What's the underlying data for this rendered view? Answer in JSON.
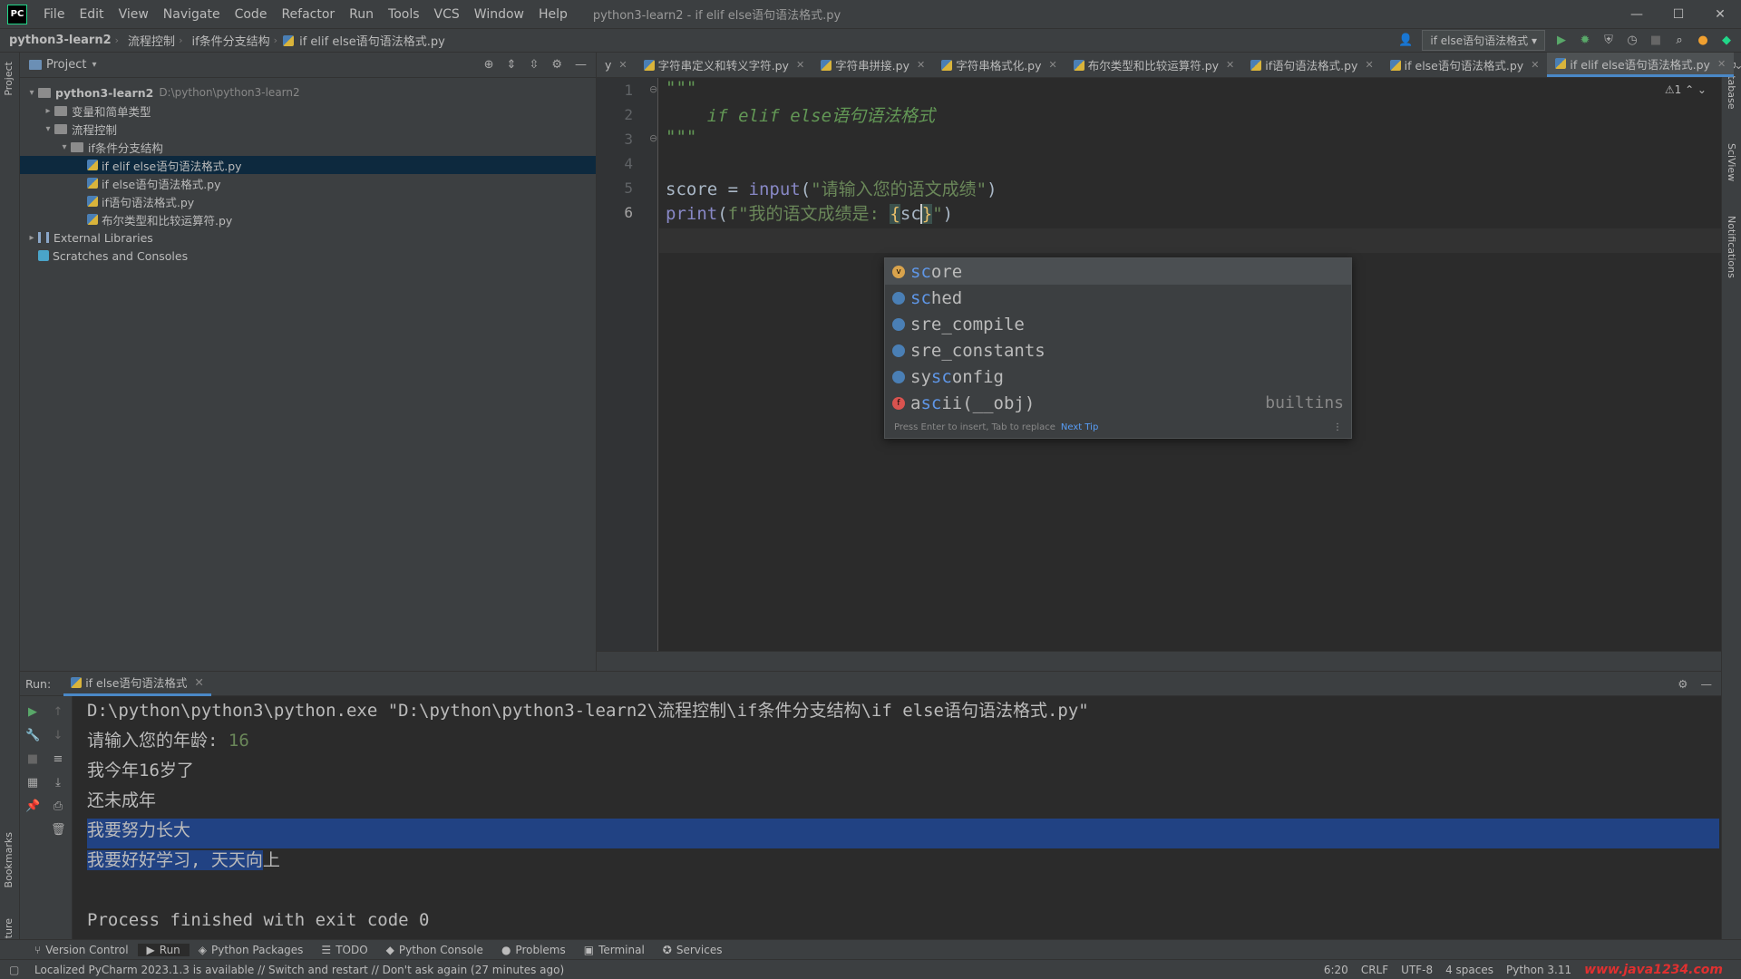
{
  "title_bar": {
    "logo": "PC",
    "menu": [
      "File",
      "Edit",
      "View",
      "Navigate",
      "Code",
      "Refactor",
      "Run",
      "Tools",
      "VCS",
      "Window",
      "Help"
    ],
    "window_title": "python3-learn2 - if elif else语句语法格式.py",
    "controls": [
      "—",
      "☐",
      "✕"
    ]
  },
  "breadcrumb": [
    "python3-learn2",
    "流程控制",
    "if条件分支结构",
    "if elif else语句语法格式.py"
  ],
  "run_config": "if else语句语法格式",
  "project_panel": {
    "title": "Project",
    "tree": [
      {
        "label": "python3-learn2",
        "path": "D:\\python\\python3-learn2",
        "type": "folder",
        "depth": 0,
        "arrow": "▾",
        "bold": true
      },
      {
        "label": "变量和简单类型",
        "type": "folder",
        "depth": 1,
        "arrow": "▸"
      },
      {
        "label": "流程控制",
        "type": "folder",
        "depth": 1,
        "arrow": "▾"
      },
      {
        "label": "if条件分支结构",
        "type": "folder",
        "depth": 2,
        "arrow": "▾"
      },
      {
        "label": "if elif else语句语法格式.py",
        "type": "py",
        "depth": 3,
        "arrow": "",
        "selected": true
      },
      {
        "label": "if else语句语法格式.py",
        "type": "py",
        "depth": 3,
        "arrow": ""
      },
      {
        "label": "if语句语法格式.py",
        "type": "py",
        "depth": 3,
        "arrow": ""
      },
      {
        "label": "布尔类型和比较运算符.py",
        "type": "py",
        "depth": 3,
        "arrow": ""
      },
      {
        "label": "External Libraries",
        "type": "lib",
        "depth": 0,
        "arrow": "▸"
      },
      {
        "label": "Scratches and Consoles",
        "type": "scratch",
        "depth": 0,
        "arrow": ""
      }
    ]
  },
  "editor_tabs": [
    {
      "label": "y",
      "partial": true
    },
    {
      "label": "字符串定义和转义字符.py"
    },
    {
      "label": "字符串拼接.py"
    },
    {
      "label": "字符串格式化.py"
    },
    {
      "label": "布尔类型和比较运算符.py"
    },
    {
      "label": "if语句语法格式.py"
    },
    {
      "label": "if else语句语法格式.py"
    },
    {
      "label": "if elif else语句语法格式.py",
      "active": true
    }
  ],
  "editor": {
    "line_numbers": [
      "1",
      "2",
      "3",
      "4",
      "5",
      "6"
    ],
    "warning": "⚠1",
    "lines": {
      "l1": "\"\"\"",
      "l2": "    if elif else语句语法格式",
      "l3": "\"\"\"",
      "l5a": "score = ",
      "l5fn": "input",
      "l5b": "(",
      "l5str": "\"请输入您的语文成绩\"",
      "l5c": ")",
      "l6fn": "print",
      "l6a": "(",
      "l6str1": "f\"我的语文成绩是: ",
      "l6br1": "{",
      "l6code": "sc",
      "l6br2": "}",
      "l6str2": "\"",
      "l6b": ")"
    }
  },
  "completion": {
    "items": [
      {
        "hl": "sc",
        "rest": "ore",
        "icon": "v",
        "icon_color": "#d9a34c",
        "tail": "",
        "selected": true
      },
      {
        "hl": "sc",
        "rest": "hed",
        "icon": "",
        "icon_color": "#4a7fb5",
        "tail": ""
      },
      {
        "pre": "s",
        "hl": "",
        "rest": "re_compile",
        "icon": "",
        "icon_color": "#4a7fb5",
        "tail": ""
      },
      {
        "pre": "s",
        "hl": "",
        "rest": "re_constants",
        "icon": "",
        "icon_color": "#4a7fb5",
        "tail": ""
      },
      {
        "pre": "sy",
        "hl": "sc",
        "rest": "onfig",
        "icon": "",
        "icon_color": "#4a7fb5",
        "tail": ""
      },
      {
        "pre": "a",
        "hl": "sc",
        "rest": "ii(__obj)",
        "icon": "f",
        "icon_color": "#d9534f",
        "tail": "builtins"
      }
    ],
    "footer": "Press Enter to insert, Tab to replace",
    "next_tip": "Next Tip"
  },
  "run_panel": {
    "label": "Run:",
    "tab": "if else语句语法格式",
    "lines": [
      "D:\\python\\python3\\python.exe \"D:\\python\\python3-learn2\\流程控制\\if条件分支结构\\if else语句语法格式.py\"",
      "请输入您的年龄: ",
      "我今年16岁了",
      "还未成年",
      "我要努力长大",
      "我要好好学习, 天天向上",
      "",
      "Process finished with exit code 0"
    ],
    "input_value": "16",
    "line6_sel": "我要好好学习, 天天向",
    "line6_rest": "上"
  },
  "bottom_tools": [
    "Version Control",
    "Run",
    "Python Packages",
    "TODO",
    "Python Console",
    "Problems",
    "Terminal",
    "Services"
  ],
  "left_strip": [
    "Project",
    "Bookmarks",
    "Structure"
  ],
  "right_strip": [
    "Database",
    "SciView",
    "Notifications"
  ],
  "status": {
    "message": "Localized PyCharm 2023.1.3 is available // Switch and restart // Don't ask again (27 minutes ago)",
    "position": "6:20",
    "line_sep": "CRLF",
    "encoding": "UTF-8",
    "indent": "4 spaces",
    "interpreter": "Python 3.11",
    "watermark": "www.java1234.com"
  }
}
